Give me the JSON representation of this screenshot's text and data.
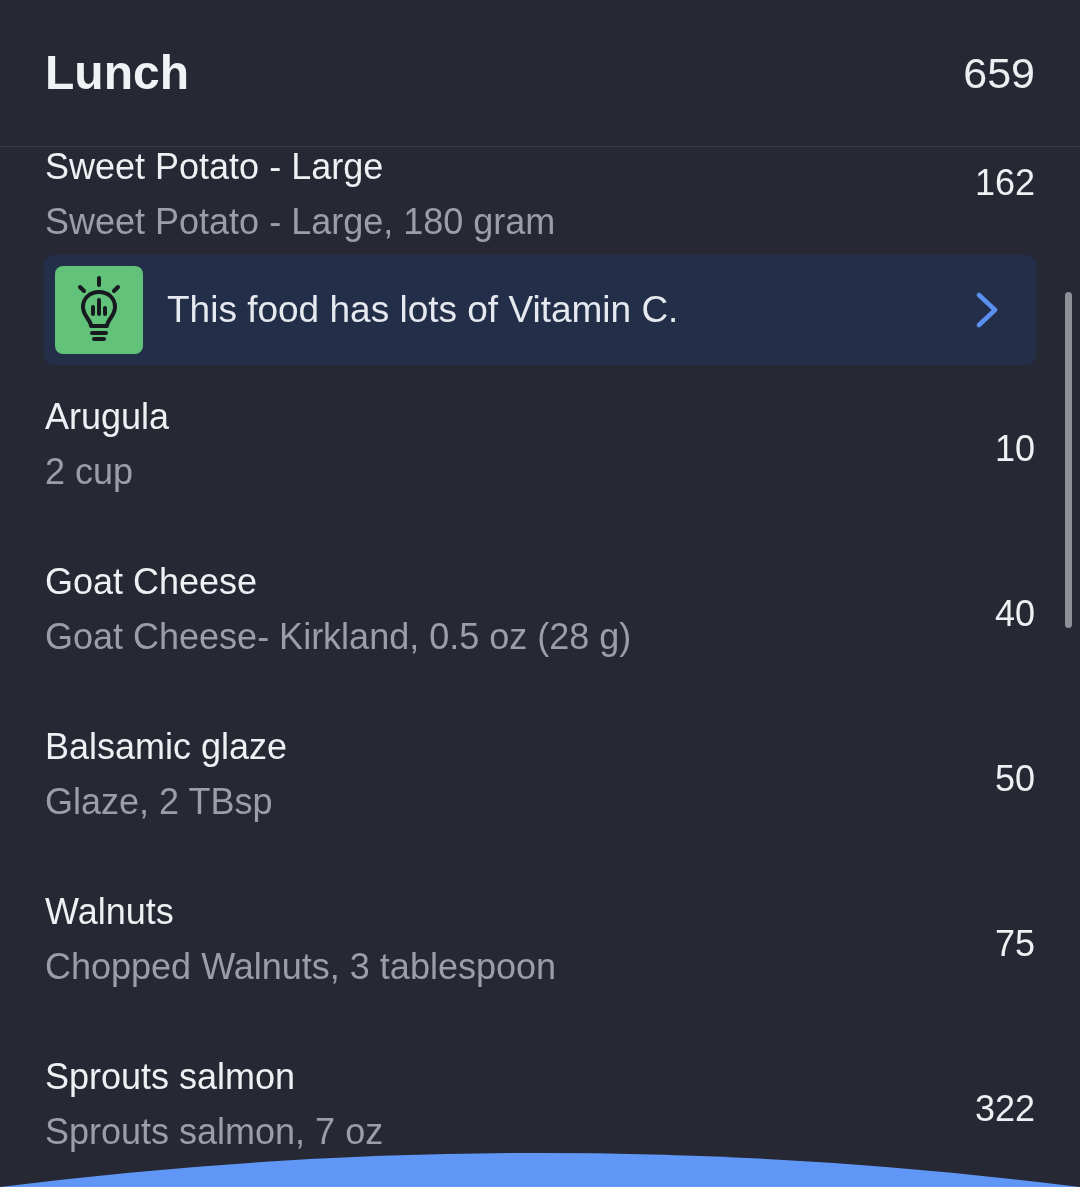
{
  "meal": {
    "title": "Lunch",
    "calories": "659"
  },
  "items": [
    {
      "kind": "food",
      "name": "Sweet Potato - Large",
      "detail": "Sweet Potato - Large, 180 gram",
      "calories": "162"
    },
    {
      "kind": "tip",
      "text": "This food has lots of Vitamin C."
    },
    {
      "kind": "food",
      "name": "Arugula",
      "detail": "2 cup",
      "calories": "10"
    },
    {
      "kind": "food",
      "name": "Goat Cheese",
      "detail": "Goat Cheese- Kirkland, 0.5 oz (28 g)",
      "calories": "40"
    },
    {
      "kind": "food",
      "name": "Balsamic glaze",
      "detail": "Glaze, 2 TBsp",
      "calories": "50"
    },
    {
      "kind": "food",
      "name": "Walnuts",
      "detail": "Chopped Walnuts, 3 tablespoon",
      "calories": "75"
    },
    {
      "kind": "food",
      "name": "Sprouts salmon",
      "detail": "Sprouts salmon, 7 oz",
      "calories": "322"
    }
  ]
}
